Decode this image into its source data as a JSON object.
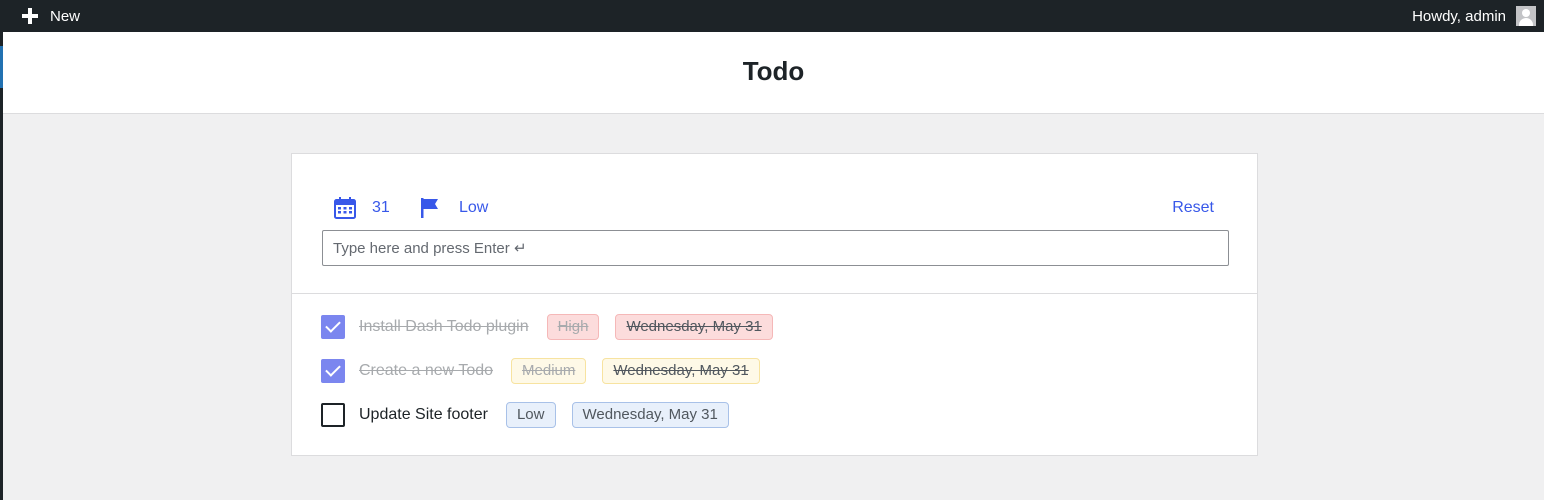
{
  "adminbar": {
    "new_label": "New",
    "howdy": "Howdy, admin"
  },
  "page": {
    "title": "Todo"
  },
  "composer": {
    "date_value": "31",
    "priority_value": "Low",
    "reset_label": "Reset",
    "placeholder": "Type here and press Enter ↵"
  },
  "todos": [
    {
      "title": "Install Dash Todo plugin",
      "priority": "High",
      "date": "Wednesday, May 31",
      "done": true
    },
    {
      "title": "Create a new Todo",
      "priority": "Medium",
      "date": "Wednesday, May 31",
      "done": true
    },
    {
      "title": "Update Site footer",
      "priority": "Low",
      "date": "Wednesday, May 31",
      "done": false
    }
  ],
  "colors": {
    "accent": "#3858e9",
    "checkbox_checked": "#7b86ef",
    "high": "#fcdcdc",
    "medium": "#fef9e7",
    "low": "#e8f0fb"
  }
}
